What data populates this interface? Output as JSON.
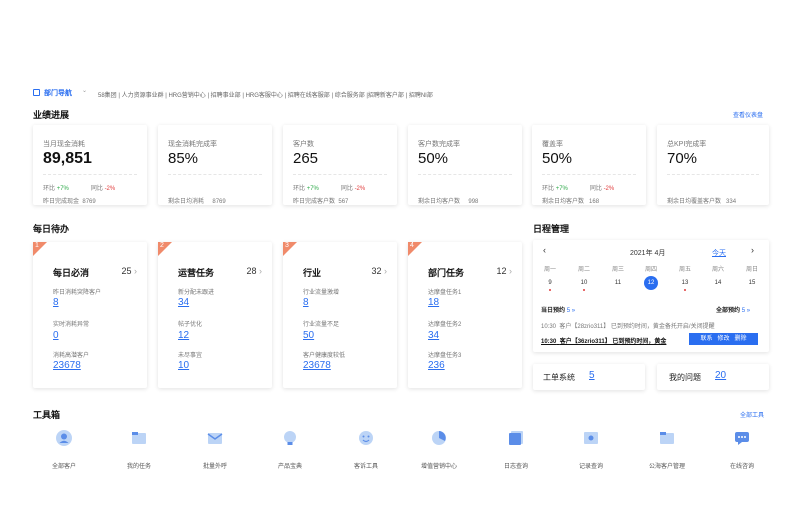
{
  "header": {
    "nav_label": "部门导航",
    "breadcrumb": "58集团 | 人力资源事业群 | HRG营销中心 | 招聘事业部 | HRG客服中心 | 招聘在线客服部 | 综合服务部 |招聘新客户部 | 招聘NI部"
  },
  "performance": {
    "title": "业绩进展",
    "dashboard_link": "查看仪表盘",
    "kpis": [
      {
        "title": "当月现金消耗",
        "value": "89,851",
        "ring_label": "环比",
        "ring": "+7%",
        "yoy_label": "同比",
        "yoy": "-2%",
        "foot_label": "昨日完成现金",
        "foot": "8769"
      },
      {
        "title": "现金消耗完成率",
        "value": "85%",
        "foot_label": "剩余日均消耗",
        "foot": "8769"
      },
      {
        "title": "客户数",
        "value": "265",
        "ring_label": "环比",
        "ring": "+7%",
        "yoy_label": "同比",
        "yoy": "-2%",
        "foot_label": "昨日完成客户数",
        "foot": "567"
      },
      {
        "title": "客户数完成率",
        "value": "50%",
        "foot_label": "剩余日均客户数",
        "foot": "998"
      },
      {
        "title": "覆盖率",
        "value": "50%",
        "ring_label": "环比",
        "ring": "+7%",
        "yoy_label": "同比",
        "yoy": "-2%",
        "foot_label": "剩余日均客户数",
        "foot": "168"
      },
      {
        "title": "总KPI完成率",
        "value": "70%",
        "foot_label": "剩余日均覆盖客户数",
        "foot": "334"
      }
    ]
  },
  "todo": {
    "title": "每日待办",
    "cards": [
      {
        "rank": "1",
        "title": "每日必消",
        "count": "25",
        "items": [
          {
            "label": "昨日消耗突降客户",
            "value": "8"
          },
          {
            "label": "实时消耗异常",
            "value": "0"
          },
          {
            "label": "消耗高潜客户",
            "value": "23678"
          }
        ]
      },
      {
        "rank": "2",
        "title": "运营任务",
        "count": "28",
        "items": [
          {
            "label": "新分配未跟进",
            "value": "34"
          },
          {
            "label": "帖子优化",
            "value": "12"
          },
          {
            "label": "未尽事宜",
            "value": "10"
          }
        ]
      },
      {
        "rank": "3",
        "title": "行业",
        "count": "32",
        "items": [
          {
            "label": "行业流量激增",
            "value": "8"
          },
          {
            "label": "行业流量不足",
            "value": "50"
          },
          {
            "label": "客户健康度较低",
            "value": "23678"
          }
        ]
      },
      {
        "rank": "4",
        "title": "部门任务",
        "count": "12",
        "items": [
          {
            "label": "达摩盘任务1",
            "value": "18"
          },
          {
            "label": "达摩盘任务2",
            "value": "34"
          },
          {
            "label": "达摩盘任务3",
            "value": "236"
          }
        ]
      }
    ]
  },
  "schedule": {
    "title": "日程管理",
    "month": "2021年 4月",
    "today": "今天",
    "weekdays": [
      "周一",
      "周二",
      "周三",
      "周四",
      "周五",
      "周六",
      "周日"
    ],
    "days": [
      "9",
      "10",
      "11",
      "12",
      "13",
      "14",
      "15"
    ],
    "today_reserve_label": "当日预约",
    "today_reserve_count": "5 »",
    "all_reserve_label": "全部预约",
    "all_reserve_count": "5 »",
    "events": [
      {
        "time": "10:30",
        "text": "客户【28zrio311】 已到预约时间，黄金备托开启/关闭提醒"
      },
      {
        "time": "10:30",
        "text": "客户【36zrio311】 已到预约时间，黄金"
      }
    ],
    "actions": [
      "联系",
      "修改",
      "删除"
    ],
    "ticket_label": "工单系统",
    "ticket_count": "5",
    "issue_label": "我的问题",
    "issue_count": "20"
  },
  "toolbox": {
    "title": "工具箱",
    "all_link": "全部工具",
    "tools": [
      "全部客户",
      "我的任务",
      "批量外呼",
      "产品宝典",
      "客诉工具",
      "增值营销中心",
      "日志查询",
      "记录查询",
      "公海客户管理",
      "在线咨询"
    ]
  },
  "colors": {
    "accent": "#2a6ef0",
    "up": "#2eaa4a",
    "down": "#e03b3b",
    "ribbon": "#f08a6a"
  }
}
